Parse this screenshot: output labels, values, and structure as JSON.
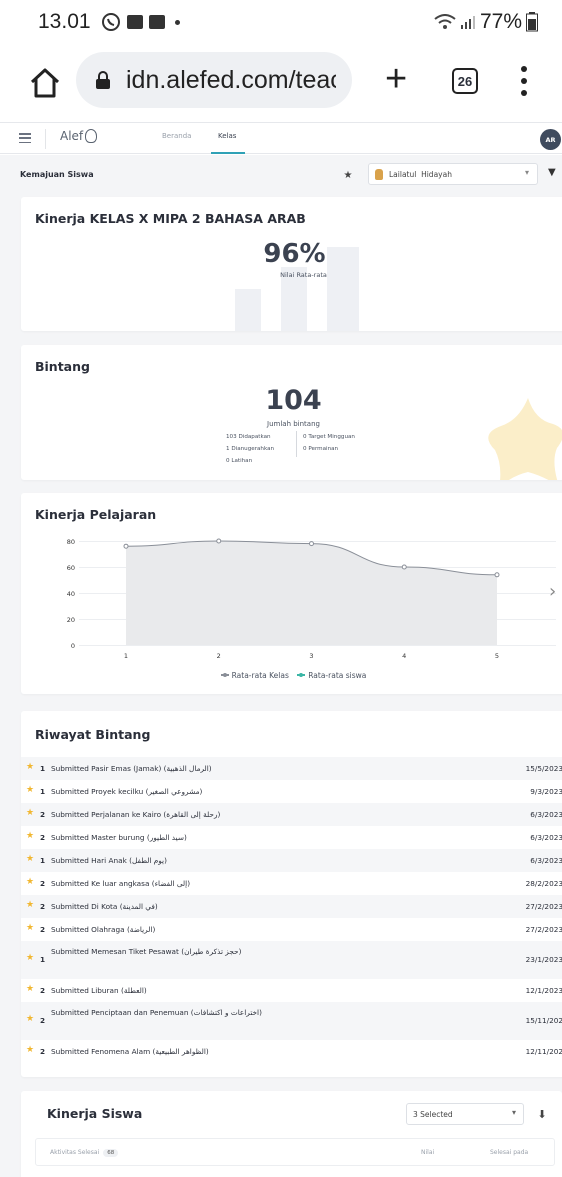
{
  "status_bar": {
    "time": "13.01",
    "battery": "77%"
  },
  "browser": {
    "url": "idn.alefed.com/teac",
    "tab_count": "26"
  },
  "app_nav": {
    "logo": "Alef",
    "tabs": [
      "Beranda",
      "Kelas"
    ],
    "active_tab": "Kelas",
    "avatar": "AR"
  },
  "page": {
    "title": "Kemajuan Siswa",
    "student_select": "Lailatul  Hidayah"
  },
  "performance": {
    "title": "Kinerja KELAS X MIPA 2 BAHASA ARAB",
    "value": "96%",
    "label": "Nilai Rata-rata"
  },
  "stars": {
    "title": "Bintang",
    "total": "104",
    "total_label": "Jumlah bintang",
    "earned": "103 Didapatkan",
    "awarded": "1 Dianugerahkan",
    "practice": "0 Latihan",
    "weekly_target": "0 Target Mingguan",
    "games": "0 Permainan"
  },
  "lesson_performance": {
    "title": "Kinerja Pelajaran",
    "legend": [
      "Rata-rata Kelas",
      "Rata-rata siswa"
    ]
  },
  "chart_data": {
    "type": "area",
    "title": "Kinerja Pelajaran",
    "x": [
      1,
      2,
      3,
      4,
      5
    ],
    "series": [
      {
        "name": "Rata-rata Kelas",
        "values": [
          76,
          80,
          78,
          60,
          54
        ]
      }
    ],
    "ylim": [
      0,
      80
    ],
    "yticks": [
      0,
      20,
      40,
      60,
      80
    ],
    "grid": true,
    "legend": "bottom",
    "colors": {
      "line": "#8a8f98",
      "fill": "#e9eaec",
      "series2": "#3bb6a6"
    }
  },
  "star_history": {
    "title": "Riwayat Bintang",
    "rows": [
      {
        "count": "1",
        "text": "Submitted Pasir Emas (Jamak) (الرمال الذهبية)",
        "date": "15/5/2023"
      },
      {
        "count": "1",
        "text": "Submitted Proyek kecilku (مشروعي الصغير)",
        "date": "9/3/2023"
      },
      {
        "count": "2",
        "text": "Submitted Perjalanan ke Kairo (رحلة إلى القاهرة)",
        "date": "6/3/2023"
      },
      {
        "count": "2",
        "text": "Submitted Master burung (سيد الطيور)",
        "date": "6/3/2023"
      },
      {
        "count": "1",
        "text": "Submitted Hari Anak (يوم الطفل)",
        "date": "6/3/2023"
      },
      {
        "count": "2",
        "text": "Submitted Ke luar angkasa (إلى الفضاء)",
        "date": "28/2/2023"
      },
      {
        "count": "2",
        "text": "Submitted Di Kota (في المدينة)",
        "date": "27/2/2023"
      },
      {
        "count": "2",
        "text": "Submitted Olahraga (الرياضة)",
        "date": "27/2/2023"
      },
      {
        "count": "1",
        "text": "Submitted Memesan Tiket Pesawat (حجز تذكرة طيران)",
        "date": "23/1/2023"
      },
      {
        "count": "2",
        "text": "Submitted Liburan (العطلة)",
        "date": "12/1/2023"
      },
      {
        "count": "2",
        "text": "Submitted Penciptaan dan Penemuan (اختراعات و اكتشافات)",
        "date": "15/11/202"
      },
      {
        "count": "2",
        "text": "Submitted Fenomena Alam (الظواهر الطبيعية)",
        "date": "12/11/202"
      }
    ]
  },
  "student_performance": {
    "title": "Kinerja Siswa",
    "select": "3 Selected",
    "col_activity": "Aktivitas Selesai",
    "activity_count": "68",
    "col_score": "Nilai",
    "col_done": "Selesai pada"
  }
}
